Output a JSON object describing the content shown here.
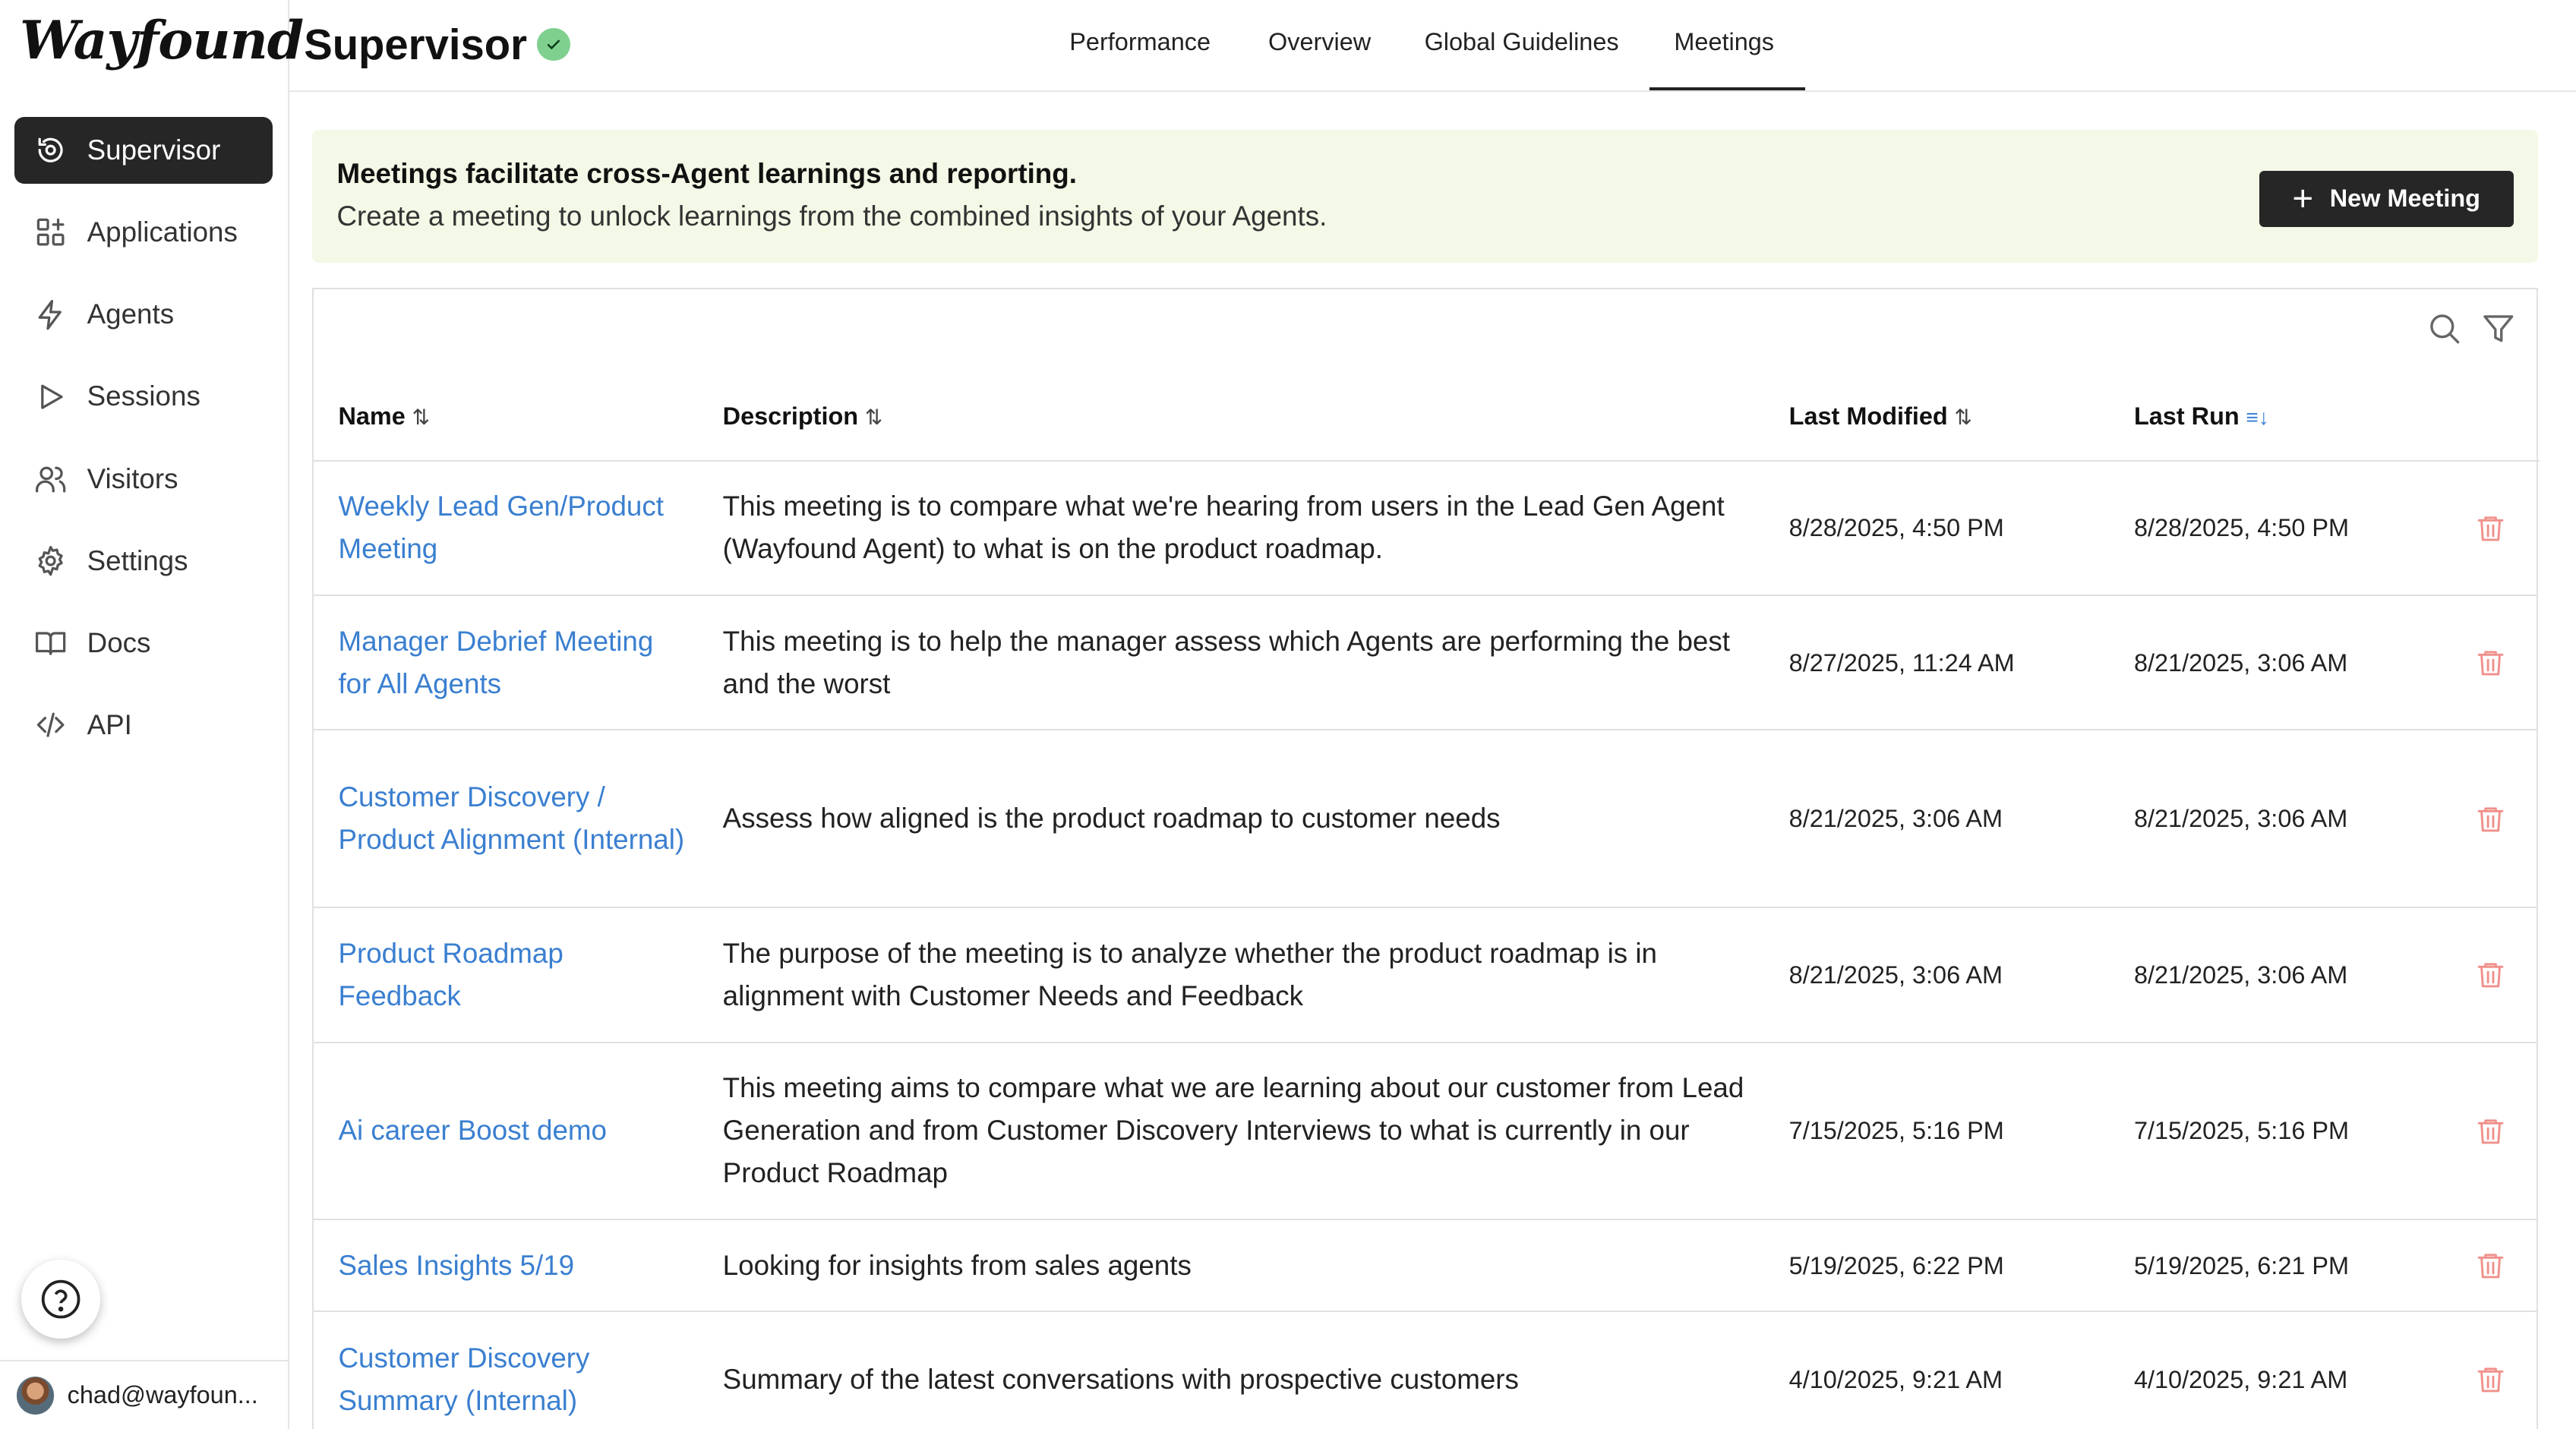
{
  "brand": {
    "logo_text": "Wayfound"
  },
  "sidebar": {
    "items": [
      {
        "label": "Supervisor",
        "icon": "supervisor-icon",
        "active": true
      },
      {
        "label": "Applications",
        "icon": "applications-icon"
      },
      {
        "label": "Agents",
        "icon": "lightning-icon"
      },
      {
        "label": "Sessions",
        "icon": "play-icon"
      },
      {
        "label": "Visitors",
        "icon": "users-icon"
      },
      {
        "label": "Settings",
        "icon": "gear-icon"
      },
      {
        "label": "Docs",
        "icon": "book-icon"
      },
      {
        "label": "API",
        "icon": "code-icon"
      }
    ],
    "user_email": "chad@wayfoun..."
  },
  "header": {
    "title": "Supervisor",
    "tabs": [
      {
        "label": "Performance"
      },
      {
        "label": "Overview"
      },
      {
        "label": "Global Guidelines"
      },
      {
        "label": "Meetings",
        "active": true
      }
    ]
  },
  "banner": {
    "title": "Meetings facilitate cross-Agent learnings and reporting.",
    "subtitle": "Create a meeting to unlock learnings from the combined insights of your Agents.",
    "button_label": "New Meeting"
  },
  "table": {
    "columns": {
      "name": "Name",
      "description": "Description",
      "last_modified": "Last Modified",
      "last_run": "Last Run"
    },
    "sort_glyph": "⇅",
    "sort_active_glyph": "≡↓",
    "rows": [
      {
        "name": "Weekly Lead Gen/Product Meeting",
        "description": "This meeting is to compare what we're hearing from users in the Lead Gen Agent (Wayfound Agent) to what is on the product roadmap.",
        "last_modified": "8/28/2025, 4:50 PM",
        "last_run": "8/28/2025, 4:50 PM"
      },
      {
        "name": "Manager Debrief Meeting for All Agents",
        "description": "This meeting is to help the manager assess which Agents are performing the best and the worst",
        "last_modified": "8/27/2025, 11:24 AM",
        "last_run": "8/21/2025, 3:06 AM"
      },
      {
        "name": "Customer Discovery / Product Alignment (Internal)",
        "description": "Assess how aligned is the product roadmap to customer needs",
        "last_modified": "8/21/2025, 3:06 AM",
        "last_run": "8/21/2025, 3:06 AM"
      },
      {
        "name": "Product Roadmap Feedback",
        "description": "The purpose of the meeting is to analyze whether the product roadmap is in alignment with Customer Needs and Feedback",
        "last_modified": "8/21/2025, 3:06 AM",
        "last_run": "8/21/2025, 3:06 AM"
      },
      {
        "name": "Ai career Boost demo",
        "description": "This meeting aims to compare what we are learning about our customer from Lead Generation and from Customer Discovery Interviews to what is currently in our Product Roadmap",
        "last_modified": "7/15/2025, 5:16 PM",
        "last_run": "7/15/2025, 5:16 PM"
      },
      {
        "name": "Sales Insights 5/19",
        "description": "Looking for insights from sales agents",
        "last_modified": "5/19/2025, 6:22 PM",
        "last_run": "5/19/2025, 6:21 PM"
      },
      {
        "name": "Customer Discovery Summary (Internal)",
        "description": "Summary of the latest conversations with prospective customers",
        "last_modified": "4/10/2025, 9:21 AM",
        "last_run": "4/10/2025, 9:21 AM"
      }
    ]
  },
  "colors": {
    "accent_dark": "#262626",
    "link_blue": "#3a7fd0",
    "banner_bg": "#f3f9e6",
    "delete_red": "#f0908a",
    "verified_green": "#7fd08f"
  }
}
